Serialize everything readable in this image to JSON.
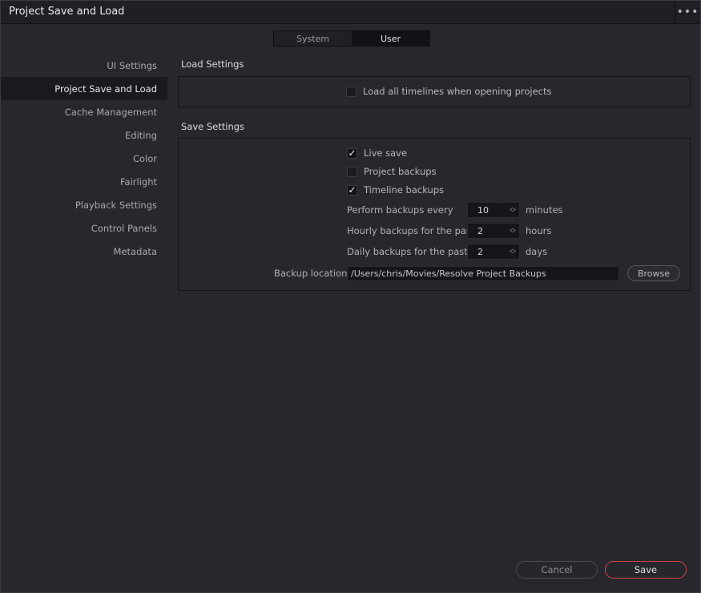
{
  "window": {
    "title": "Project Save and Load",
    "more_icon": "more-horizontal-icon",
    "more_glyph": "•••"
  },
  "tabs": [
    {
      "label": "System",
      "active": false
    },
    {
      "label": "User",
      "active": true
    }
  ],
  "sidebar": {
    "items": [
      {
        "label": "UI Settings",
        "active": false
      },
      {
        "label": "Project Save and Load",
        "active": true
      },
      {
        "label": "Cache Management",
        "active": false
      },
      {
        "label": "Editing",
        "active": false
      },
      {
        "label": "Color",
        "active": false
      },
      {
        "label": "Fairlight",
        "active": false
      },
      {
        "label": "Playback Settings",
        "active": false
      },
      {
        "label": "Control Panels",
        "active": false
      },
      {
        "label": "Metadata",
        "active": false
      }
    ]
  },
  "load_settings": {
    "title": "Load Settings",
    "load_all_timelines": {
      "label": "Load all timelines when opening projects",
      "checked": false
    }
  },
  "save_settings": {
    "title": "Save Settings",
    "live_save": {
      "label": "Live save",
      "checked": true
    },
    "project_backups": {
      "label": "Project backups",
      "checked": false
    },
    "timeline_backups": {
      "label": "Timeline backups",
      "checked": true
    },
    "perform_every": {
      "label": "Perform backups every",
      "value": "10",
      "unit": "minutes"
    },
    "hourly": {
      "label": "Hourly backups for the past",
      "value": "2",
      "unit": "hours"
    },
    "daily": {
      "label": "Daily backups for the past",
      "value": "2",
      "unit": "days"
    },
    "backup_location": {
      "label": "Backup location",
      "value": "/Users/chris/Movies/Resolve Project Backups",
      "browse_label": "Browse"
    }
  },
  "footer": {
    "cancel_label": "Cancel",
    "save_label": "Save"
  },
  "colors": {
    "accent_save_border": "#d9473f",
    "background": "#27272d"
  },
  "glyphs": {
    "check": "✓",
    "up": "︿",
    "down": "﹀"
  }
}
